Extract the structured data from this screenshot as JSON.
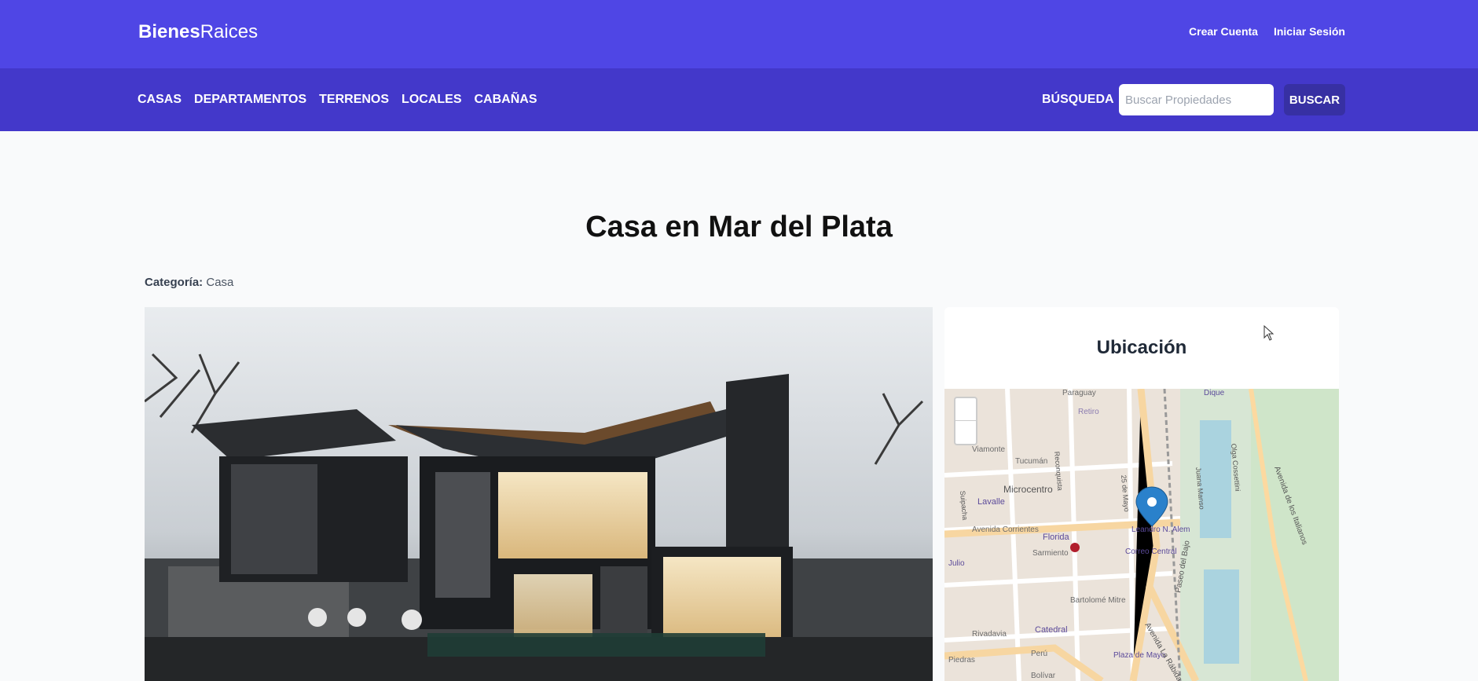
{
  "header": {
    "logo_bold": "Bienes",
    "logo_light": "Raices",
    "create_account": "Crear Cuenta",
    "sign_in": "Iniciar Sesión"
  },
  "nav": {
    "items": [
      "CASAS",
      "DEPARTAMENTOS",
      "TERRENOS",
      "LOCALES",
      "CABAÑAS"
    ],
    "search_label": "BÚSQUEDA",
    "search_placeholder": "Buscar Propiedades",
    "search_button": "BUSCAR"
  },
  "property": {
    "title": "Casa en Mar del Plata",
    "category_label": "Categoría:",
    "category_value": "Casa"
  },
  "location": {
    "title": "Ubicación",
    "map_labels": [
      "Paraguay",
      "Retiro",
      "Viamonte",
      "Microcentro",
      "Lavalle",
      "Avenida Corrientes",
      "Florida",
      "Sarmiento",
      "Leandro N. Alem",
      "Correo Central",
      "Paseo del Bajo",
      "Bartolomé Mitre",
      "Avenida La Rábida",
      "Catedral",
      "Rivadavia",
      "Perú",
      "Plaza de Mayo",
      "Bolívar",
      "Piedras",
      "Avenida de los Italianos",
      "Juana Manso",
      "Olga Cossettini",
      "Dique",
      "Julio",
      "Tucumán",
      "Reconquista",
      "25 de Mayo",
      "Suipacha"
    ]
  },
  "colors": {
    "header_bg": "#4f46e5",
    "nav_bg": "#4338ca",
    "button_bg": "#3730a3"
  }
}
